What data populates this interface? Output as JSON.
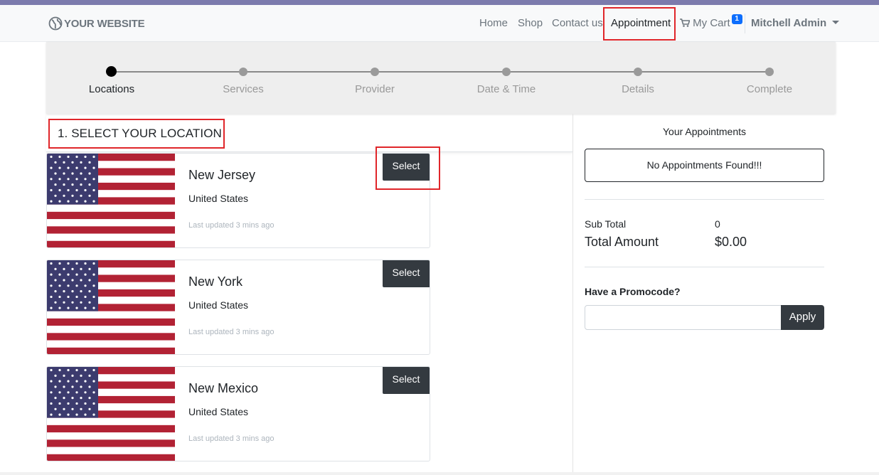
{
  "site": {
    "logo_text": "YOUR WEBSITE"
  },
  "nav": {
    "home": "Home",
    "shop": "Shop",
    "contact": "Contact us",
    "appointment": "Appointment",
    "cart": "My Cart",
    "cart_count": "1",
    "user": "Mitchell Admin"
  },
  "steps": [
    "Locations",
    "Services",
    "Provider",
    "Date & Time",
    "Details",
    "Complete"
  ],
  "active_step": "Locations",
  "section": {
    "title": "1. SELECT YOUR LOCATION"
  },
  "locations": [
    {
      "name": "New Jersey",
      "country": "United States",
      "updated": "Last updated 3 mins ago",
      "button": "Select"
    },
    {
      "name": "New York",
      "country": "United States",
      "updated": "Last updated 3 mins ago",
      "button": "Select"
    },
    {
      "name": "New Mexico",
      "country": "United States",
      "updated": "Last updated 3 mins ago",
      "button": "Select"
    }
  ],
  "sidebar": {
    "title": "Your Appointments",
    "empty_message": "No Appointments Found!!!",
    "subtotal_label": "Sub Total",
    "subtotal_value": "0",
    "total_label": "Total Amount",
    "total_value": "$0.00",
    "promo_label": "Have a Promocode?",
    "promo_placeholder": "",
    "apply_label": "Apply"
  },
  "colors": {
    "top_stripe": "#7c7bad",
    "dark_button": "#343a40",
    "badge": "#0d6efd",
    "highlight": "#e0262a",
    "flag_red": "#b22234",
    "flag_blue": "#3c3b6e"
  }
}
